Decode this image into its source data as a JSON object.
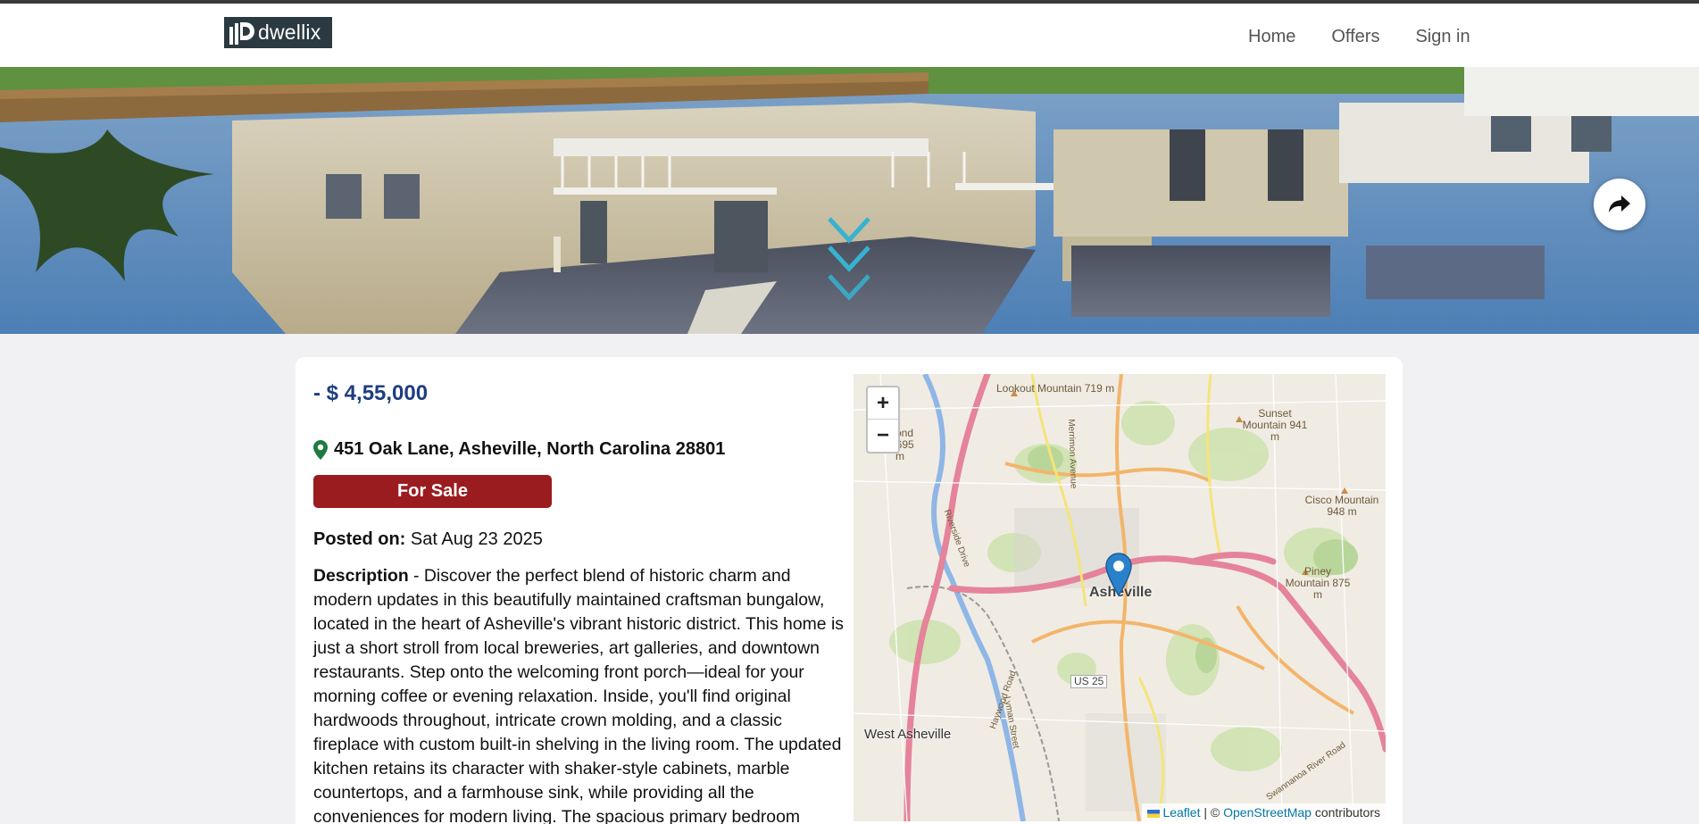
{
  "brand": {
    "name": "dwellix"
  },
  "nav": {
    "home": "Home",
    "offers": "Offers",
    "sign_in": "Sign in"
  },
  "listing": {
    "price": "- $ 4,55,000",
    "address": "451 Oak Lane, Asheville, North Carolina 28801",
    "status": "For Sale",
    "posted_label": "Posted on:",
    "posted_date": "Sat Aug 23 2025",
    "description_label": "Description",
    "description": " - Discover the perfect blend of historic charm and modern updates in this beautifully maintained craftsman bungalow, located in the heart of Asheville's vibrant historic district. This home is just a short stroll from local breweries, art galleries, and downtown restaurants. Step onto the welcoming front porch—ideal for your morning coffee or evening relaxation. Inside, you'll find original hardwoods throughout, intricate crown molding, and a classic fireplace with custom built-in shelving in the living room. The updated kitchen retains its character with shaker-style cabinets, marble countertops, and a farmhouse sink, while providing all the conveniences for modern living. The spacious primary bedroom"
  },
  "map": {
    "zoom_in": "+",
    "zoom_out": "−",
    "city": "Asheville",
    "labels": {
      "lookout": "Lookout Mountain 719 m",
      "sunset": "Sunset Mountain 941 m",
      "cisco": "Cisco Mountain 948 m",
      "piney": "Piney Mountain 875 m",
      "richmond": "mond ill 695 m",
      "west_asheville": "West Asheville",
      "us25": "US 25",
      "merrimon": "Merrimon Avenue",
      "riverside": "Riverside Drive",
      "haywood": "Haywood Road",
      "lyman": "Lyman Street",
      "swannanoa": "Swannanoa River Road"
    },
    "attribution": {
      "leaflet": "Leaflet",
      "sep": " | © ",
      "osm": "OpenStreetMap",
      "contributors": " contributors"
    }
  },
  "colors": {
    "accent": "#1f3d80",
    "status_bg": "#9b1c1f",
    "chevron": "#35b3d1",
    "marker": "#2a81cb"
  },
  "icons": {
    "share": "share-arrow-icon",
    "scroll": "chevron-down-icon",
    "pin": "map-pin-icon",
    "marker": "map-marker-icon"
  }
}
